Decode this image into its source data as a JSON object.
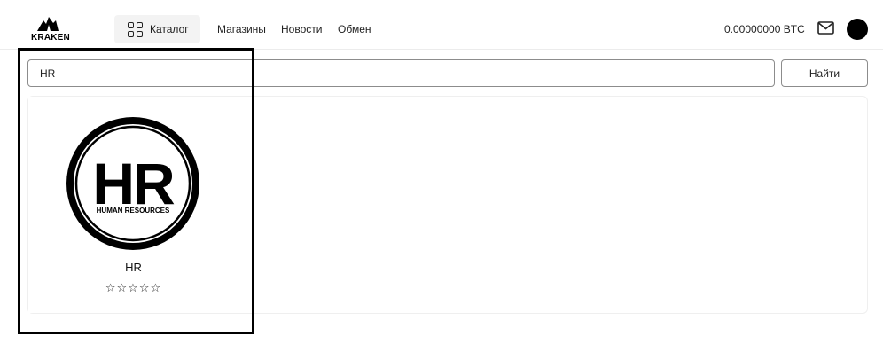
{
  "header": {
    "logo_text": "KRAKEN",
    "catalog_label": "Каталог",
    "nav": [
      "Магазины",
      "Новости",
      "Обмен"
    ],
    "balance": "0.00000000 BTC",
    "icons": {
      "catalog": "grid-icon",
      "mail": "mail-icon",
      "avatar": "avatar"
    }
  },
  "search": {
    "value": "HR",
    "button_label": "Найти"
  },
  "results": [
    {
      "title": "HR",
      "logo_big_text": "HR",
      "logo_small_text": "HUMAN RESOURCES",
      "rating": 0,
      "stars": "☆☆☆☆☆"
    }
  ],
  "colors": {
    "accent": "#000000",
    "border": "#8c8c8c",
    "panel_border": "#efefef",
    "catalog_bg": "#f3f3f3"
  }
}
